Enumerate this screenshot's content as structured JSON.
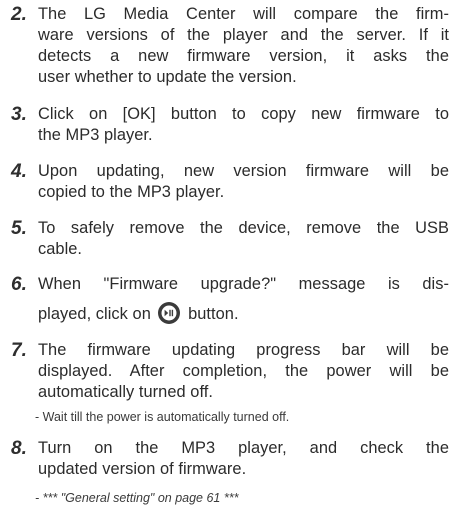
{
  "steps": [
    {
      "number": "2.",
      "lines": [
        "The LG Media Center will compare the firm-",
        "ware versions of the player and the server. If it",
        "detects a new firmware version, it asks the",
        "user whether to update the version."
      ]
    },
    {
      "number": "3.",
      "lines": [
        "Click on [OK] button to copy new firmware to",
        "the MP3 player."
      ]
    },
    {
      "number": "4.",
      "lines": [
        "Upon updating, new version firmware will be",
        "copied to the MP3 player."
      ]
    },
    {
      "number": "5.",
      "lines": [
        "To safely remove the device, remove the USB",
        "cable."
      ]
    },
    {
      "number": "6.",
      "line1": "When \"Firmware upgrade?\" message is dis-",
      "line2_before": "played, click on",
      "line2_after": "button."
    },
    {
      "number": "7.",
      "lines": [
        "The firmware updating progress bar will be",
        "displayed. After completion, the power will be",
        "automatically turned off."
      ],
      "note": "- Wait till the power is automatically turned off."
    },
    {
      "number": "8.",
      "lines": [
        "Turn on the MP3 player, and check the",
        "updated version of firmware."
      ],
      "note": "- *** \"General setting\" on page 61 ***"
    }
  ],
  "icons": {
    "play_pause": "play-pause-button-icon"
  }
}
